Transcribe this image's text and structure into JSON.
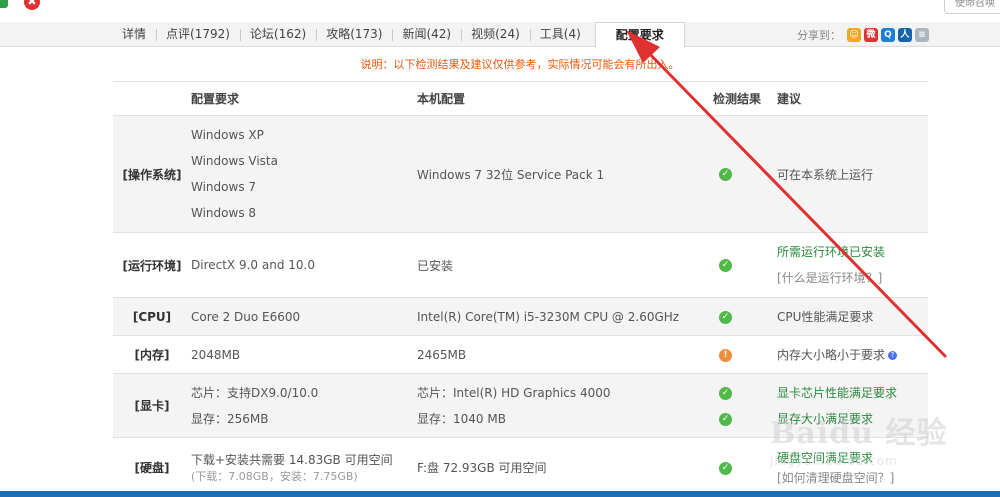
{
  "window": {
    "close_glyph": "✖",
    "top_right_button": "使命召唤"
  },
  "tabs": [
    {
      "label": "详情"
    },
    {
      "label": "点评(1792)"
    },
    {
      "label": "论坛(162)"
    },
    {
      "label": "攻略(173)"
    },
    {
      "label": "新闻(42)"
    },
    {
      "label": "视频(24)"
    },
    {
      "label": "工具(4)"
    },
    {
      "label": "配置要求",
      "active": true
    }
  ],
  "share": {
    "label": "分享到：",
    "icons": [
      {
        "name": "qzone-icon",
        "color": "#f5a623",
        "glyph": "☺"
      },
      {
        "name": "sina-weibo-icon",
        "color": "#e03131",
        "glyph": "微"
      },
      {
        "name": "tencent-weibo-icon",
        "color": "#1c7ed6",
        "glyph": "Q"
      },
      {
        "name": "renren-icon",
        "color": "#1864ab",
        "glyph": "人"
      },
      {
        "name": "more-share-icon",
        "color": "#adb5bd",
        "glyph": "≡"
      }
    ]
  },
  "notice": "说明：以下检测结果及建议仅供参考，实际情况可能会有所出入。",
  "table": {
    "headers": {
      "category": "",
      "required": "配置要求",
      "local": "本机配置",
      "result": "检测结果",
      "advice": "建议"
    },
    "os": {
      "category": "[操作系统]",
      "required": [
        "Windows XP",
        "Windows Vista",
        "Windows 7",
        "Windows 8"
      ],
      "local": "Windows 7 32位  Service Pack 1",
      "advice": "可在本系统上运行"
    },
    "runtime": {
      "category": "[运行环境]",
      "required": "DirectX 9.0 and 10.0",
      "local": "已安装",
      "advice": "所需运行环境已安装",
      "advice_link": "[什么是运行环境？]"
    },
    "cpu": {
      "category": "[CPU]",
      "required": "Core 2 Duo E6600",
      "local": "Intel(R) Core(TM) i5-3230M CPU @ 2.60GHz",
      "advice": "CPU性能满足要求"
    },
    "memory": {
      "category": "[内存]",
      "required": "2048MB",
      "local": "2465MB",
      "advice": "内存大小略小于要求"
    },
    "gpu": {
      "category": "[显卡]",
      "required": [
        "芯片：支持DX9.0/10.0",
        "显存：256MB"
      ],
      "local": [
        "芯片：Intel(R) HD Graphics 4000",
        "显存：1040 MB"
      ],
      "advice": [
        "显卡芯片性能满足要求",
        "显存大小满足要求"
      ]
    },
    "disk": {
      "category": "[硬盘]",
      "required": "下载+安装共需要  14.83GB 可用空间",
      "required_detail": "(下载：7.08GB，安装：7.75GB)",
      "local": "F:盘  72.93GB 可用空间",
      "advice": "硬盘空间满足要求",
      "advice_link": "[如何清理硬盘空间？]"
    }
  },
  "watermark": {
    "main": "Baidu 经验",
    "sub": "jingyan.baidu.com"
  },
  "colors": {
    "accent_orange": "#e8590c",
    "ok_green": "#2b8a3e",
    "annotation_red": "#e03131",
    "bottom_bar": "#1c6fb7"
  }
}
